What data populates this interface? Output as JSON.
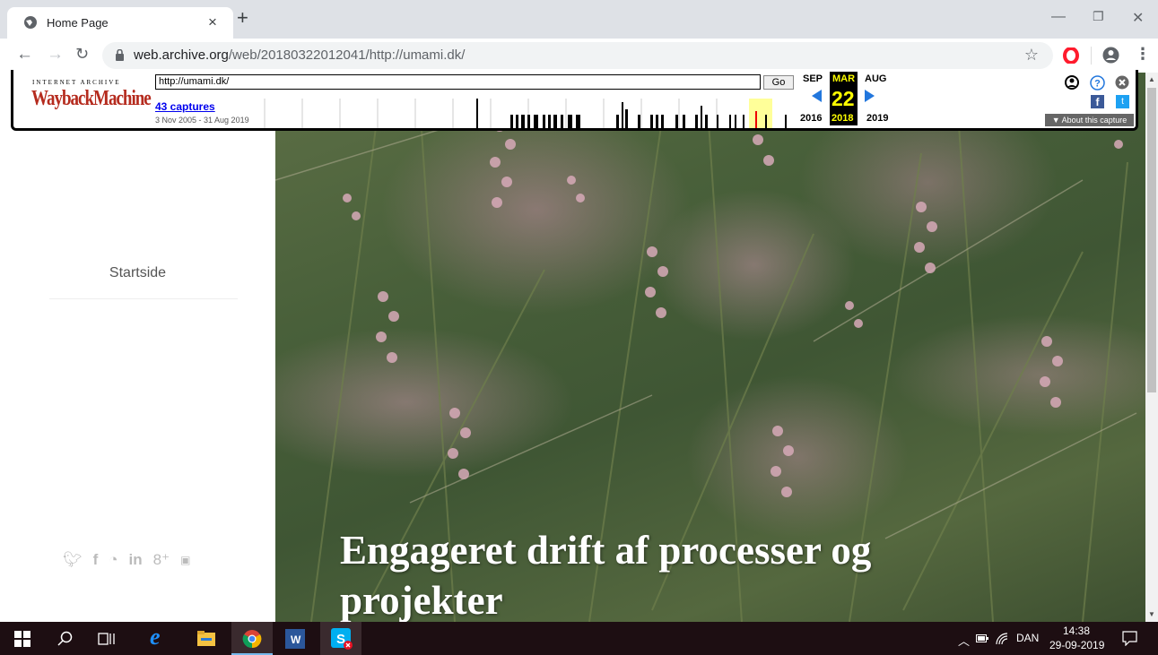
{
  "browser": {
    "tab_title": "Home Page",
    "tab_close": "×",
    "new_tab": "+",
    "url_host": "web.archive.org",
    "url_path": "/web/20180322012041/http://umami.dk/",
    "star": "☆"
  },
  "wayback": {
    "logo_top": "INTERNET ARCHIVE",
    "logo": "WaybackMachine",
    "url_value": "http://umami.dk/",
    "go_label": "Go",
    "captures": "43 captures",
    "range": "3 Nov 2005 - 31 Aug 2019",
    "prev_month": "SEP",
    "cur_month": "MAR",
    "next_month": "AUG",
    "cur_day": "22",
    "prev_year": "2016",
    "cur_year": "2018",
    "next_year": "2019",
    "about": "▼ About this capture"
  },
  "site": {
    "menu_item": "Startside",
    "hero_line1": "Engageret drift af processer og",
    "hero_line2": "projekter",
    "social_icons": [
      "twitter-icon",
      "facebook-icon",
      "rss-icon",
      "linkedin-icon",
      "googleplus-icon",
      "youtube-icon"
    ]
  },
  "taskbar": {
    "language": "DAN",
    "time": "14:38",
    "date": "29-09-2019"
  }
}
